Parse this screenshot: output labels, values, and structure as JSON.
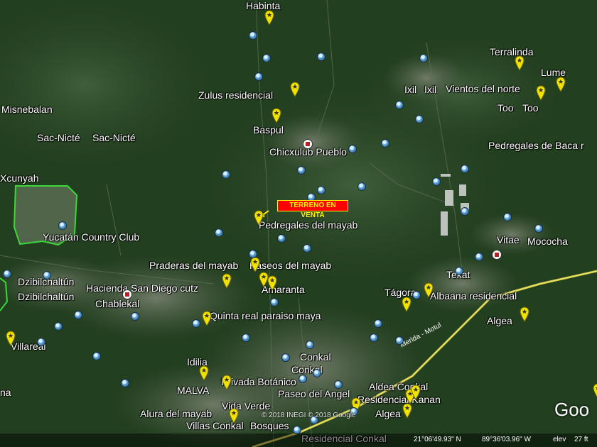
{
  "map": {
    "labels": [
      {
        "id": "habinta",
        "text": "Habinta"
      },
      {
        "id": "terralinda",
        "text": "Terralinda"
      },
      {
        "id": "lume",
        "text": "Lume"
      },
      {
        "id": "zulus",
        "text": "Zulus residencial"
      },
      {
        "id": "ixil1",
        "text": "Ixil"
      },
      {
        "id": "ixil2",
        "text": "Ixil"
      },
      {
        "id": "vientos",
        "text": "Vientos del norte"
      },
      {
        "id": "misnebalan",
        "text": "Misnebalan"
      },
      {
        "id": "too1",
        "text": "Too"
      },
      {
        "id": "too2",
        "text": "Too"
      },
      {
        "id": "baspul",
        "text": "Baspul"
      },
      {
        "id": "sacnicte1",
        "text": "Sac-Nicté"
      },
      {
        "id": "sacnicte2",
        "text": "Sac-Nicté"
      },
      {
        "id": "chicxulub",
        "text": "Chicxulub Pueblo"
      },
      {
        "id": "pedregales_baca",
        "text": "Pedregales de Baca r"
      },
      {
        "id": "xcunyah",
        "text": "Xcunyah"
      },
      {
        "id": "pedregales_mayab",
        "text": "Pedregales del mayab"
      },
      {
        "id": "yucatan_cc",
        "text": "Yucatán Country Club"
      },
      {
        "id": "vitae",
        "text": "Vitae"
      },
      {
        "id": "mococha",
        "text": "Mococha"
      },
      {
        "id": "praderas",
        "text": "Praderas del mayab"
      },
      {
        "id": "paseos",
        "text": "Paseos del mayab"
      },
      {
        "id": "tekat",
        "text": "Tekat"
      },
      {
        "id": "dzib1",
        "text": "Dzibilchaltún"
      },
      {
        "id": "dzib2",
        "text": "Dzibilchaltún"
      },
      {
        "id": "hacienda",
        "text": "Hacienda San Diego cutz"
      },
      {
        "id": "amaranta",
        "text": "Amaranta"
      },
      {
        "id": "tagora",
        "text": "Tágora"
      },
      {
        "id": "albaana",
        "text": "Albaana residencial"
      },
      {
        "id": "chablekal",
        "text": "Chablekal"
      },
      {
        "id": "algea1",
        "text": "Algea"
      },
      {
        "id": "quinta",
        "text": "Quinta real paraiso maya"
      },
      {
        "id": "villareal",
        "text": "Villareal"
      },
      {
        "id": "conkal1",
        "text": "Conkal"
      },
      {
        "id": "conkal2",
        "text": "Conkal"
      },
      {
        "id": "idilia",
        "text": "Idilia"
      },
      {
        "id": "privada",
        "text": "Privada Botánico"
      },
      {
        "id": "malva",
        "text": "MALVA"
      },
      {
        "id": "aldea",
        "text": "Aldea Conkal"
      },
      {
        "id": "paseo_angel",
        "text": "Paseo del Angel"
      },
      {
        "id": "kanan",
        "text": "Residencial Kanan"
      },
      {
        "id": "alura",
        "text": "Alura del mayab"
      },
      {
        "id": "vida_verde",
        "text": "Vida Verde"
      },
      {
        "id": "algea2",
        "text": "Algea"
      },
      {
        "id": "villas",
        "text": "Villas Conkal"
      },
      {
        "id": "bosques",
        "text": "Bosques"
      },
      {
        "id": "res_conkal",
        "text": "Residencial Conkal"
      },
      {
        "id": "edge_na",
        "text": "na"
      }
    ],
    "road_label": "Merida - Motul",
    "callout": "TERRENO EN VENTA",
    "copyright": "© 2018 INEGI  © 2018 Google",
    "brand": "Goo",
    "colors": {
      "pin": "#f2e200",
      "callout_bg": "#ff0000",
      "callout_text": "#fff200",
      "road": "#e8df5a",
      "boundary": "#3dd63d"
    }
  },
  "status": {
    "lat": "21°06'49.93\" N",
    "lon": "89°36'03.96\" W",
    "elev_label": "elev",
    "elev_value": "27 ft"
  }
}
